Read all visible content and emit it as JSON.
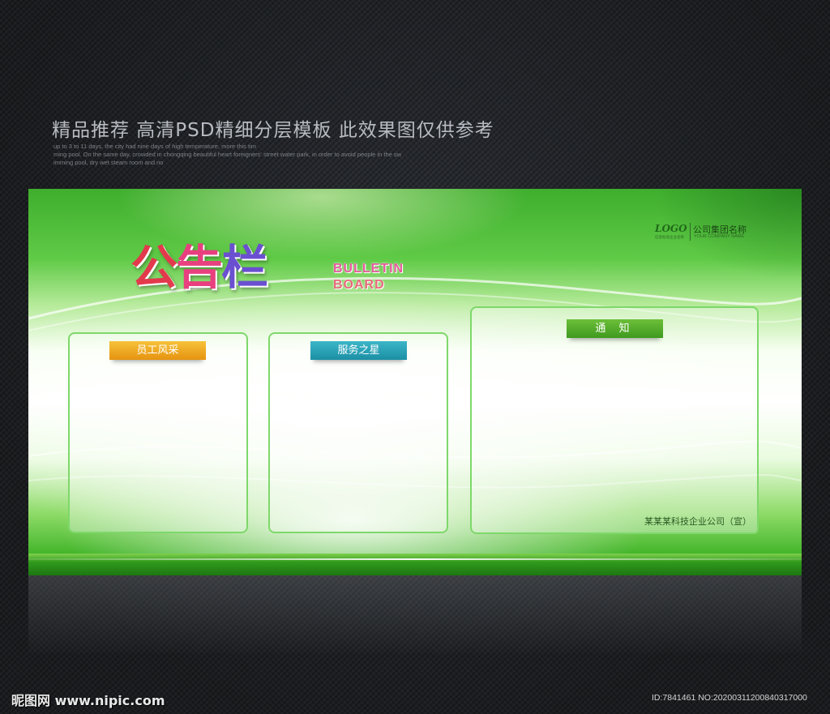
{
  "header": {
    "title": "精品推荐 高清PSD精细分层模板 此效果图仅供参考",
    "sub_lines": [
      "up to 3 to 11 days, the city had nine days of high temperature, more this tim",
      "ming pool. On the same day, crowded in chongqing beautiful heart foreigners' street water park, in order to avoid people in the sw",
      "imming pool, dry wet steam room and no"
    ]
  },
  "board": {
    "logo_text": "LOGO",
    "logo_tagline": "信息标语企业名称",
    "company_name": "公司集团名称",
    "company_name_en": "YOUR COMPANY NAME",
    "title_chars": [
      "公",
      "告",
      "栏"
    ],
    "title_en_line1": "BULLETIN",
    "title_en_line2": "BOARD",
    "panels": [
      {
        "label": "员工风采",
        "label_color": "#f0a020"
      },
      {
        "label": "服务之星",
        "label_color": "#28a4b8"
      },
      {
        "label": "通 知",
        "label_color": "#4ea82a"
      }
    ],
    "footer": "某某某科技企业公司（宣）",
    "colors": {
      "primary_green": "#3fb327",
      "panel_border": "#7ed86a"
    }
  },
  "watermark": {
    "site": "昵图网 www.nipic.com",
    "id": "ID:7841461 NO:20200311200840317000"
  }
}
